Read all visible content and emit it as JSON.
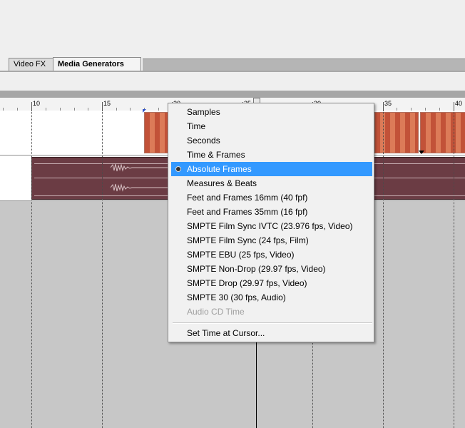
{
  "tabs": [
    {
      "label": "Video FX",
      "active": false
    },
    {
      "label": "Media Generators",
      "active": true
    }
  ],
  "ruler": {
    "labels": [
      "10",
      "15",
      "20",
      "25",
      "30",
      "35",
      "40"
    ]
  },
  "context_menu": {
    "items": [
      {
        "label": "Samples"
      },
      {
        "label": "Time"
      },
      {
        "label": "Seconds"
      },
      {
        "label": "Time & Frames"
      },
      {
        "label": "Absolute Frames",
        "selected": true
      },
      {
        "label": "Measures & Beats"
      },
      {
        "label": "Feet and Frames 16mm (40 fpf)"
      },
      {
        "label": "Feet and Frames 35mm (16 fpf)"
      },
      {
        "label": "SMPTE Film Sync IVTC (23.976 fps, Video)"
      },
      {
        "label": "SMPTE Film Sync (24 fps, Film)"
      },
      {
        "label": "SMPTE EBU (25 fps, Video)"
      },
      {
        "label": "SMPTE Non-Drop (29.97 fps, Video)"
      },
      {
        "label": "SMPTE Drop (29.97 fps, Video)"
      },
      {
        "label": "SMPTE 30 (30 fps, Audio)"
      },
      {
        "label": "Audio CD Time",
        "disabled": true
      }
    ],
    "footer_item": {
      "label": "Set Time at Cursor..."
    }
  },
  "colors": {
    "selection": "#3399ff",
    "audio_clip": "#6b3c44",
    "video_clip": "#e9a387"
  }
}
